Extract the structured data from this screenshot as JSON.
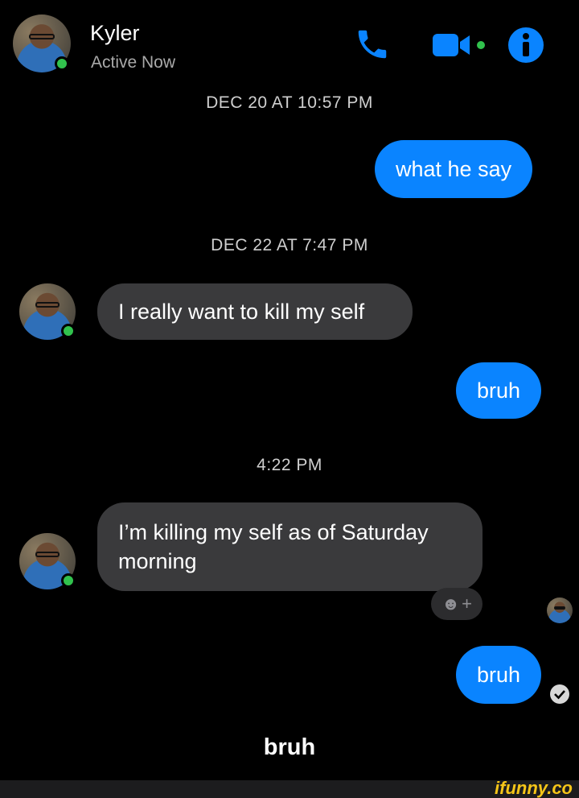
{
  "header": {
    "contact_name": "Kyler",
    "status": "Active Now",
    "icons": [
      "phone-icon",
      "video-camera-icon",
      "info-icon"
    ]
  },
  "conversation": {
    "timestamp_1": "DEC 20 AT 10:57 PM",
    "msg_1": "what he say",
    "timestamp_2": "DEC 22 AT 7:47 PM",
    "msg_2": "I really want to kill my self",
    "msg_3": "bruh",
    "timestamp_3": "4:22 PM",
    "msg_4": "I’m killing my self as of Saturday morning",
    "msg_5": "bruh"
  },
  "caption": "bruh",
  "watermark": "ifunny.co",
  "colors": {
    "outgoing_bubble": "#0a84ff",
    "incoming_bubble": "#3a3a3c",
    "accent": "#0a84ff",
    "online": "#31c24d"
  }
}
